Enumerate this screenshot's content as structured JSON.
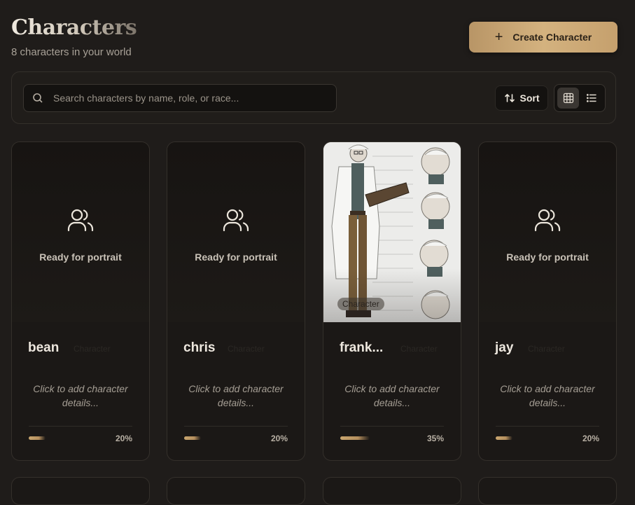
{
  "header": {
    "title": "Characters",
    "subtitle": "8 characters in your world",
    "create_label": "Create Character"
  },
  "search": {
    "placeholder": "Search characters by name, role, or race...",
    "value": ""
  },
  "toolbar": {
    "sort_label": "Sort",
    "view_mode": "grid"
  },
  "colors": {
    "accent_gold": "#c9a66f",
    "background": "#1f1c1a"
  },
  "characters": [
    {
      "name": "bean",
      "role": "Character",
      "portrait_text": "Ready for portrait",
      "details": "Click to add character details...",
      "progress": 20,
      "progress_label": "20%",
      "has_image": false
    },
    {
      "name": "chris",
      "role": "Character",
      "portrait_text": "Ready for portrait",
      "details": "Click to add character details...",
      "progress": 20,
      "progress_label": "20%",
      "has_image": false
    },
    {
      "name": "frank...",
      "role": "Character",
      "portrait_text": "",
      "details": "Click to add character details...",
      "progress": 35,
      "progress_label": "35%",
      "has_image": true,
      "image_badge": "Character"
    },
    {
      "name": "jay",
      "role": "Character",
      "portrait_text": "Ready for portrait",
      "details": "Click to add character details...",
      "progress": 20,
      "progress_label": "20%",
      "has_image": false
    }
  ]
}
